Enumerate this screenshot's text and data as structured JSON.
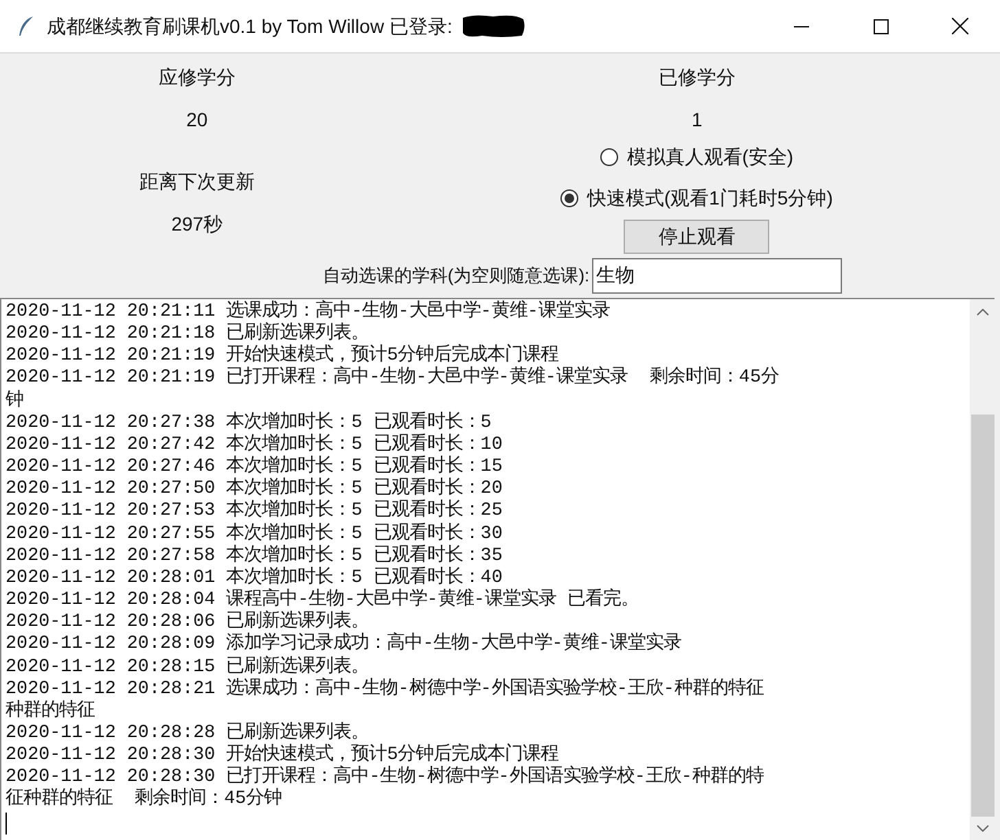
{
  "window": {
    "title": "成都继续教育刷课机v0.1 by Tom Willow 已登录:"
  },
  "required_credits": {
    "label": "应修学分",
    "value": "20"
  },
  "earned_credits": {
    "label": "已修学分",
    "value": "1"
  },
  "next_update": {
    "label": "距离下次更新",
    "value": "297秒"
  },
  "modes": [
    {
      "label": "模拟真人观看(安全)",
      "selected": false
    },
    {
      "label": "快速模式(观看1门耗时5分钟)",
      "selected": true
    }
  ],
  "stop_button": "停止观看",
  "subject": {
    "label": "自动选课的学科(为空则随意选课):",
    "value": "生物"
  },
  "log_lines": [
    "2020-11-12 20:21:11 选课成功：高中-生物-大邑中学-黄维-课堂实录",
    "2020-11-12 20:21:18 已刷新选课列表。",
    "2020-11-12 20:21:19 开始快速模式，预计5分钟后完成本门课程",
    "2020-11-12 20:21:19 已打开课程：高中-生物-大邑中学-黄维-课堂实录  剩余时间：45分",
    "钟",
    "2020-11-12 20:27:38 本次增加时长：5 已观看时长：5",
    "2020-11-12 20:27:42 本次增加时长：5 已观看时长：10",
    "2020-11-12 20:27:46 本次增加时长：5 已观看时长：15",
    "2020-11-12 20:27:50 本次增加时长：5 已观看时长：20",
    "2020-11-12 20:27:53 本次增加时长：5 已观看时长：25",
    "2020-11-12 20:27:55 本次增加时长：5 已观看时长：30",
    "2020-11-12 20:27:58 本次增加时长：5 已观看时长：35",
    "2020-11-12 20:28:01 本次增加时长：5 已观看时长：40",
    "2020-11-12 20:28:04 课程高中-生物-大邑中学-黄维-课堂实录 已看完。",
    "2020-11-12 20:28:06 已刷新选课列表。",
    "2020-11-12 20:28:09 添加学习记录成功：高中-生物-大邑中学-黄维-课堂实录",
    "2020-11-12 20:28:15 已刷新选课列表。",
    "2020-11-12 20:28:21 选课成功：高中-生物-树德中学-外国语实验学校-王欣-种群的特征",
    "种群的特征",
    "2020-11-12 20:28:28 已刷新选课列表。",
    "2020-11-12 20:28:30 开始快速模式，预计5分钟后完成本门课程",
    "2020-11-12 20:28:30 已打开课程：高中-生物-树德中学-外国语实验学校-王欣-种群的特",
    "征种群的特征  剩余时间：45分钟"
  ]
}
